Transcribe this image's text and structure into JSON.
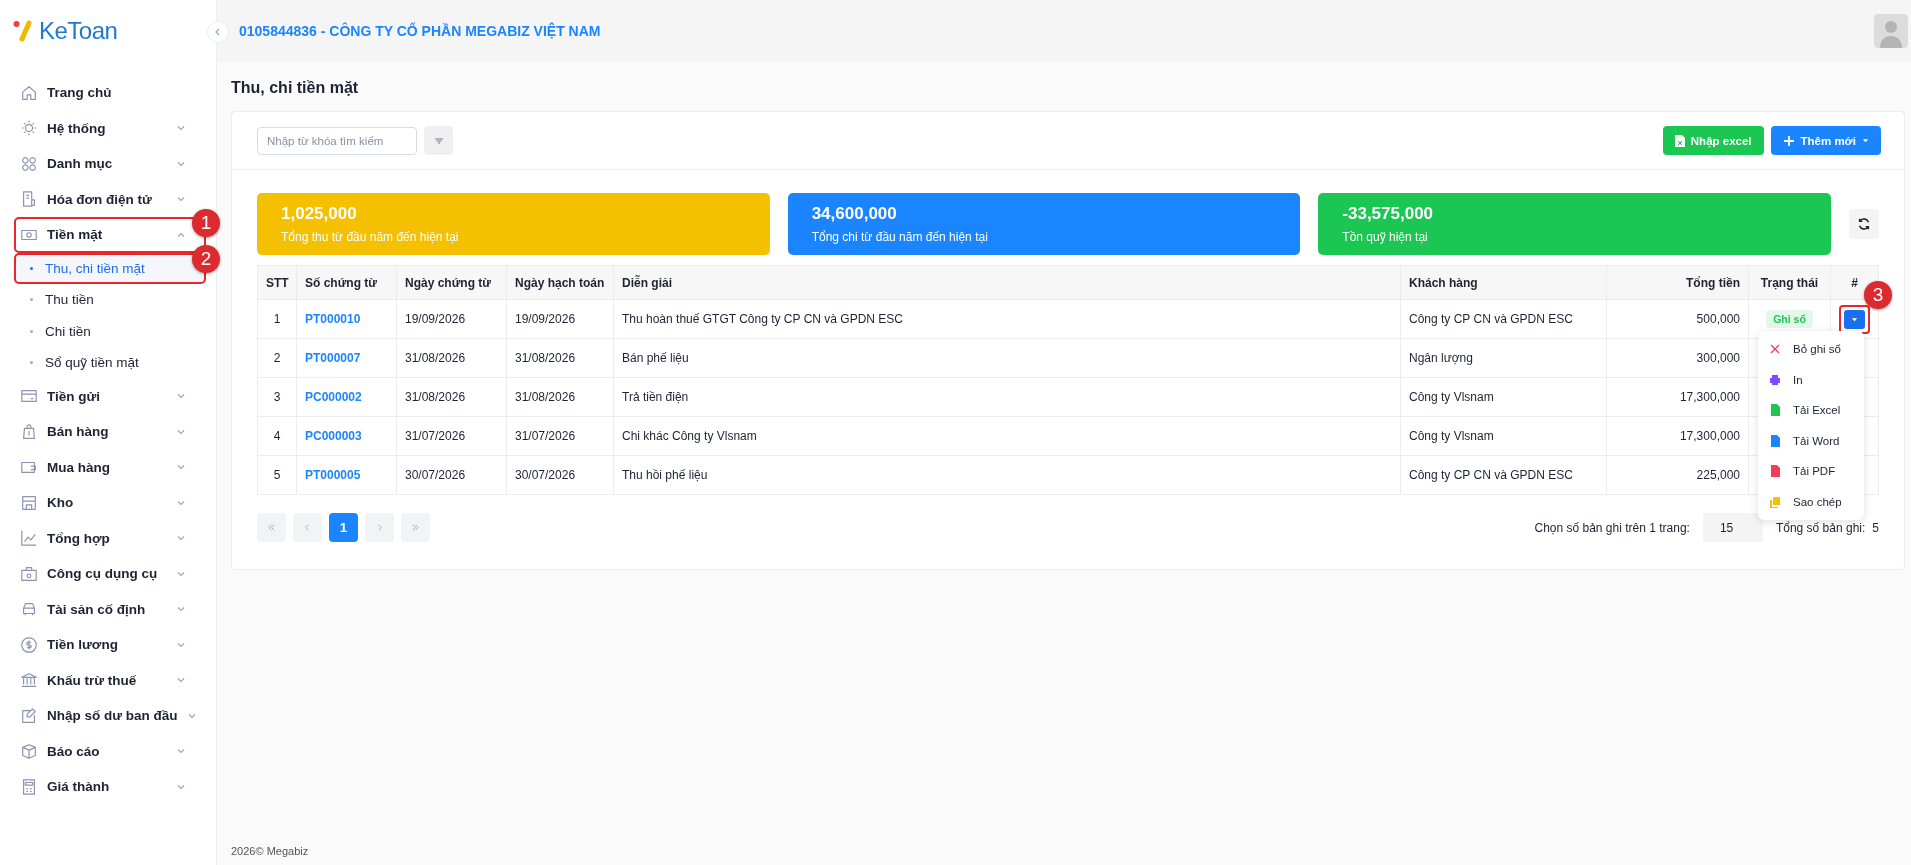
{
  "logo": {
    "text": "KeToan"
  },
  "header": {
    "company": "0105844836 - CÔNG TY CỔ PHẦN MEGABIZ VIỆT NAM"
  },
  "sidebar": {
    "items": [
      {
        "label": "Trang chủ",
        "expandable": false
      },
      {
        "label": "Hệ thống",
        "expandable": true,
        "expanded": false
      },
      {
        "label": "Danh mục",
        "expandable": true,
        "expanded": false
      },
      {
        "label": "Hóa đơn điện tử",
        "expandable": true,
        "expanded": false
      },
      {
        "label": "Tiền mặt",
        "expandable": true,
        "expanded": true,
        "annotation": "1",
        "children": [
          {
            "label": "Thu, chi tiền mặt",
            "selected": true,
            "annotation": "2"
          },
          {
            "label": "Thu tiền",
            "selected": false
          },
          {
            "label": "Chi tiền",
            "selected": false
          },
          {
            "label": "Sổ quỹ tiền mặt",
            "selected": false
          }
        ]
      },
      {
        "label": "Tiền gửi",
        "expandable": true,
        "expanded": false
      },
      {
        "label": "Bán hàng",
        "expandable": true,
        "expanded": false
      },
      {
        "label": "Mua hàng",
        "expandable": true,
        "expanded": false
      },
      {
        "label": "Kho",
        "expandable": true,
        "expanded": false
      },
      {
        "label": "Tổng hợp",
        "expandable": true,
        "expanded": false
      },
      {
        "label": "Công cụ dụng cụ",
        "expandable": true,
        "expanded": false
      },
      {
        "label": "Tài sản cố định",
        "expandable": true,
        "expanded": false
      },
      {
        "label": "Tiền lương",
        "expandable": true,
        "expanded": false
      },
      {
        "label": "Khấu trừ thuế",
        "expandable": true,
        "expanded": false
      },
      {
        "label": "Nhập số dư ban đầu",
        "expandable": true,
        "expanded": false
      },
      {
        "label": "Báo cáo",
        "expandable": true,
        "expanded": false
      },
      {
        "label": "Giá thành",
        "expandable": true,
        "expanded": false
      }
    ]
  },
  "page_title": "Thu, chi tiền mặt",
  "toolbar": {
    "search": {
      "placeholder": "Nhập từ khóa tìm kiếm"
    },
    "buttons": [
      {
        "label": "Nhập excel",
        "kind": "import"
      },
      {
        "label": "Thêm mới",
        "kind": "add"
      }
    ]
  },
  "stats": [
    {
      "value": "1,025,000",
      "label": "Tổng thu từ đầu năm đến hiện tại",
      "color": "#f5c000"
    },
    {
      "value": "34,600,000",
      "label": "Tổng chi từ đầu năm đến hiện tại",
      "color": "#1a85ff"
    },
    {
      "value": "-33,575,000",
      "label": "Tồn quỹ hiện tại",
      "color": "#1bc653"
    }
  ],
  "table": {
    "columns": [
      "STT",
      "Số chứng từ",
      "Ngày chứng từ",
      "Ngày hạch toán",
      "Diễn giải",
      "Khách hàng",
      "Tổng tiền",
      "Trạng thái",
      "#"
    ],
    "rows": [
      {
        "stt": "1",
        "number": "PT000010",
        "doc_date": "19/09/2026",
        "post_date": "19/09/2026",
        "description": "Thu hoàn thuế GTGT Công ty CP CN và GPDN ESC",
        "customer": "Công ty CP CN và GPDN ESC",
        "total": "500,000",
        "status": "Ghi sổ",
        "menu_button": true,
        "annotation": "3"
      },
      {
        "stt": "2",
        "number": "PT000007",
        "doc_date": "31/08/2026",
        "post_date": "31/08/2026",
        "description": "Bán phế liệu",
        "customer": "Ngân lượng",
        "total": "300,000"
      },
      {
        "stt": "3",
        "number": "PC000002",
        "doc_date": "31/08/2026",
        "post_date": "31/08/2026",
        "description": "Trả tiền điện",
        "customer": "Công ty Vlsnam",
        "total": "17,300,000"
      },
      {
        "stt": "4",
        "number": "PC000003",
        "doc_date": "31/07/2026",
        "post_date": "31/07/2026",
        "description": "Chi khác Công ty Vlsnam",
        "customer": "Công ty Vlsnam",
        "total": "17,300,000"
      },
      {
        "stt": "5",
        "number": "PT000005",
        "doc_date": "30/07/2026",
        "post_date": "30/07/2026",
        "description": "Thu hồi phế liệu",
        "customer": "Công ty CP CN và GPDN ESC",
        "total": "225,000"
      }
    ]
  },
  "row_menu": {
    "items": [
      {
        "label": "Bỏ ghi sổ",
        "kind": "remove"
      },
      {
        "label": "In",
        "kind": "print"
      },
      {
        "label": "Tải Excel",
        "kind": "excel"
      },
      {
        "label": "Tải Word",
        "kind": "word"
      },
      {
        "label": "Tải PDF",
        "kind": "pdf"
      },
      {
        "label": "Sao chép",
        "kind": "copy"
      }
    ]
  },
  "pagination": {
    "pages": [
      {
        "label": "1",
        "selected": true
      }
    ],
    "page_size_label": "Chọn số bản ghi trên 1 trang:",
    "page_size": "15",
    "total_label": "Tổng số bản ghi:",
    "total": "5"
  },
  "footer": {
    "text": "2026© Megabiz"
  }
}
